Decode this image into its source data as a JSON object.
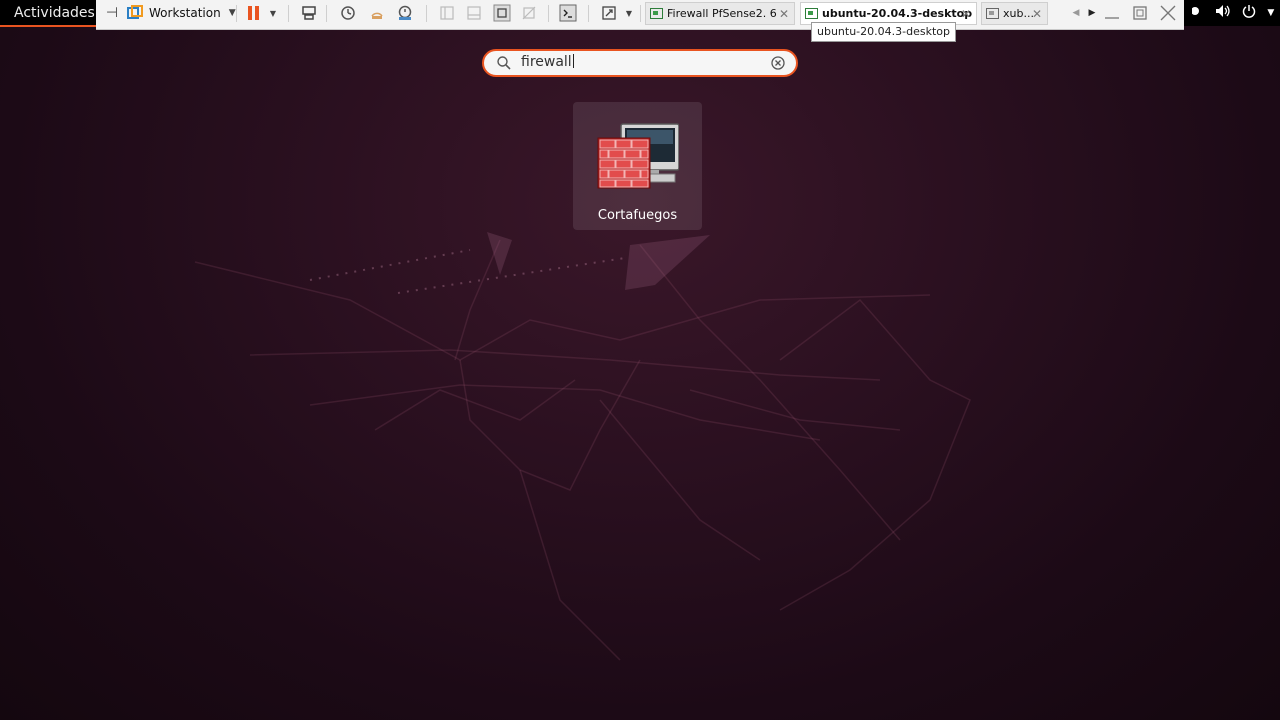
{
  "topbar": {
    "activities_label": "Actividades"
  },
  "vm_toolbar": {
    "workstation_label": "Workstation",
    "tabs": [
      {
        "label": "Firewall PfSense2. 6",
        "active": false
      },
      {
        "label": "ubuntu-20.04.3-desktop",
        "active": true
      },
      {
        "label": "xub...",
        "active": false
      }
    ],
    "tooltip": "ubuntu-20.04.3-desktop"
  },
  "search": {
    "value": "firewall"
  },
  "results": [
    {
      "label": "Cortafuegos",
      "icon": "firewall-icon"
    }
  ],
  "colors": {
    "accent": "#e95420",
    "topbar": "#000000",
    "wallpaper": "#2b1020"
  }
}
